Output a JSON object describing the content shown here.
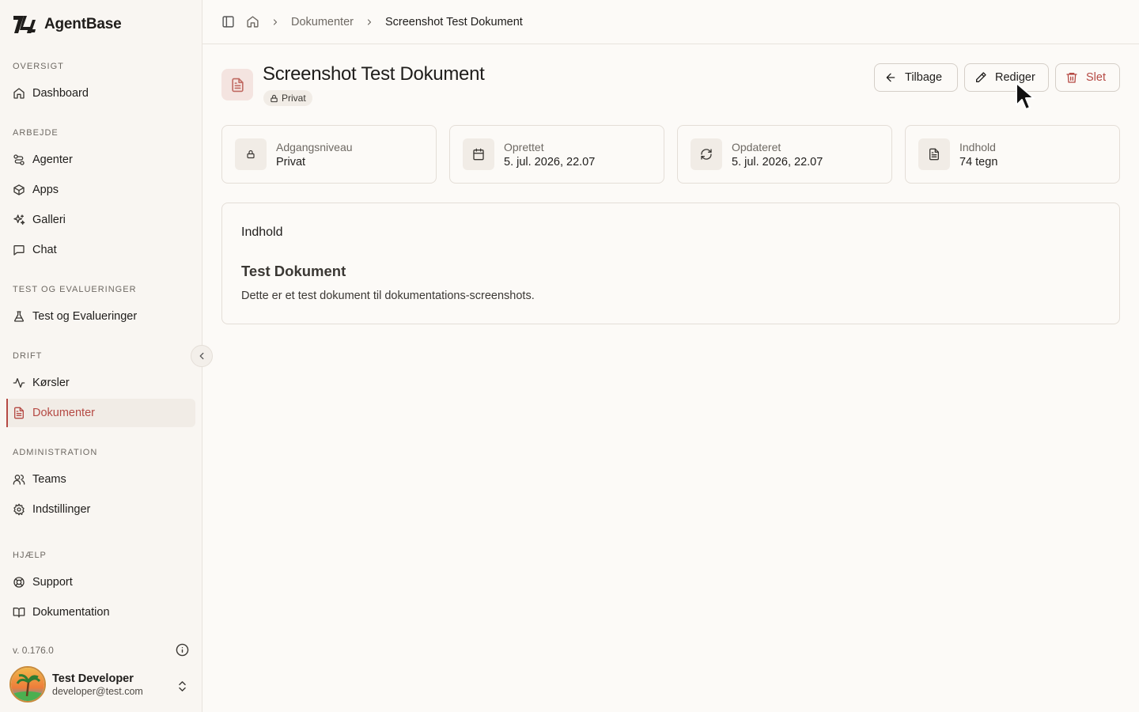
{
  "app": {
    "name": "AgentBase"
  },
  "sidebar": {
    "sections": [
      {
        "label": "OVERSIGT"
      },
      {
        "label": "ARBEJDE"
      },
      {
        "label": "TEST OG EVALUERINGER"
      },
      {
        "label": "DRIFT"
      },
      {
        "label": "ADMINISTRATION"
      },
      {
        "label": "HJÆLP"
      }
    ],
    "items": [
      {
        "label": "Dashboard",
        "icon": "home-icon"
      },
      {
        "label": "Agenter",
        "icon": "route-icon"
      },
      {
        "label": "Apps",
        "icon": "box-icon"
      },
      {
        "label": "Galleri",
        "icon": "sparkles-icon"
      },
      {
        "label": "Chat",
        "icon": "message-icon"
      },
      {
        "label": "Test og Evalueringer",
        "icon": "flask-icon"
      },
      {
        "label": "Kørsler",
        "icon": "activity-icon"
      },
      {
        "label": "Dokumenter",
        "icon": "file-text-icon",
        "active": true
      },
      {
        "label": "Teams",
        "icon": "users-icon"
      },
      {
        "label": "Indstillinger",
        "icon": "settings-icon"
      },
      {
        "label": "Support",
        "icon": "lifebuoy-icon"
      },
      {
        "label": "Dokumentation",
        "icon": "book-icon"
      }
    ],
    "version": "v. 0.176.0",
    "user": {
      "name": "Test Developer",
      "email": "developer@test.com"
    }
  },
  "breadcrumb": {
    "parent": "Dokumenter",
    "current": "Screenshot Test Dokument"
  },
  "document": {
    "title": "Screenshot Test Dokument",
    "badge": "Privat",
    "actions": {
      "back": "Tilbage",
      "edit": "Rediger",
      "delete": "Slet"
    }
  },
  "stats": [
    {
      "label": "Adgangsniveau",
      "value": "Privat",
      "icon": "lock-icon"
    },
    {
      "label": "Oprettet",
      "value": "5. jul. 2026, 22.07",
      "icon": "calendar-icon"
    },
    {
      "label": "Opdateret",
      "value": "5. jul. 2026, 22.07",
      "icon": "refresh-icon"
    },
    {
      "label": "Indhold",
      "value": "74 tegn",
      "icon": "file-text-icon"
    }
  ],
  "content": {
    "label": "Indhold",
    "heading": "Test Dokument",
    "body": "Dette er et test dokument til dokumentations-screenshots."
  },
  "colors": {
    "accent": "#b54a44",
    "background": "#fcfaf7",
    "sidebar": "#f9f6f2"
  }
}
